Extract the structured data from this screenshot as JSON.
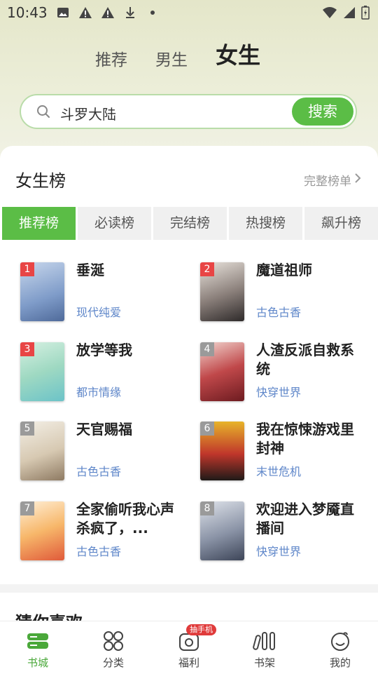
{
  "status_bar": {
    "time": "10:43",
    "icons": [
      "image-icon",
      "warning-icon",
      "warning-icon",
      "download-icon",
      "dot-icon"
    ],
    "right_icons": [
      "wifi-icon",
      "signal-icon",
      "battery-icon"
    ]
  },
  "top_tabs": [
    {
      "label": "推荐",
      "active": false
    },
    {
      "label": "男生",
      "active": false
    },
    {
      "label": "女生",
      "active": true
    }
  ],
  "search": {
    "value": "斗罗大陆",
    "button_label": "搜索"
  },
  "section": {
    "title": "女生榜",
    "full_list_label": "完整榜单"
  },
  "rank_tabs": [
    {
      "label": "推荐榜",
      "active": true
    },
    {
      "label": "必读榜",
      "active": false
    },
    {
      "label": "完结榜",
      "active": false
    },
    {
      "label": "热搜榜",
      "active": false
    },
    {
      "label": "飙升榜",
      "active": false
    }
  ],
  "books": [
    {
      "rank": "1",
      "title": "垂涎",
      "tag": "现代纯爱"
    },
    {
      "rank": "2",
      "title": "魔道祖师",
      "tag": "古色古香"
    },
    {
      "rank": "3",
      "title": "放学等我",
      "tag": "都市情缘"
    },
    {
      "rank": "4",
      "title": "人渣反派自救系统",
      "tag": "快穿世界"
    },
    {
      "rank": "5",
      "title": "天官赐福",
      "tag": "古色古香"
    },
    {
      "rank": "6",
      "title": "我在惊悚游戏里封神",
      "tag": "末世危机"
    },
    {
      "rank": "7",
      "title": "全家偷听我心声杀疯了，...",
      "tag": "古色古香"
    },
    {
      "rank": "8",
      "title": "欢迎进入梦魇直播间",
      "tag": "快穿世界"
    }
  ],
  "guess_section": {
    "title": "猜你喜欢"
  },
  "bottom_nav": [
    {
      "label": "书城",
      "icon": "bookstore-icon",
      "active": true
    },
    {
      "label": "分类",
      "icon": "category-icon",
      "active": false
    },
    {
      "label": "福利",
      "icon": "gift-icon",
      "active": false,
      "badge": "抽手机"
    },
    {
      "label": "书架",
      "icon": "bookshelf-icon",
      "active": false
    },
    {
      "label": "我的",
      "icon": "profile-icon",
      "active": false
    }
  ],
  "colors": {
    "accent": "#5bbd46",
    "tag": "#5e86c9",
    "badge_top": "#e84545",
    "badge_other": "#9a9a9a"
  }
}
